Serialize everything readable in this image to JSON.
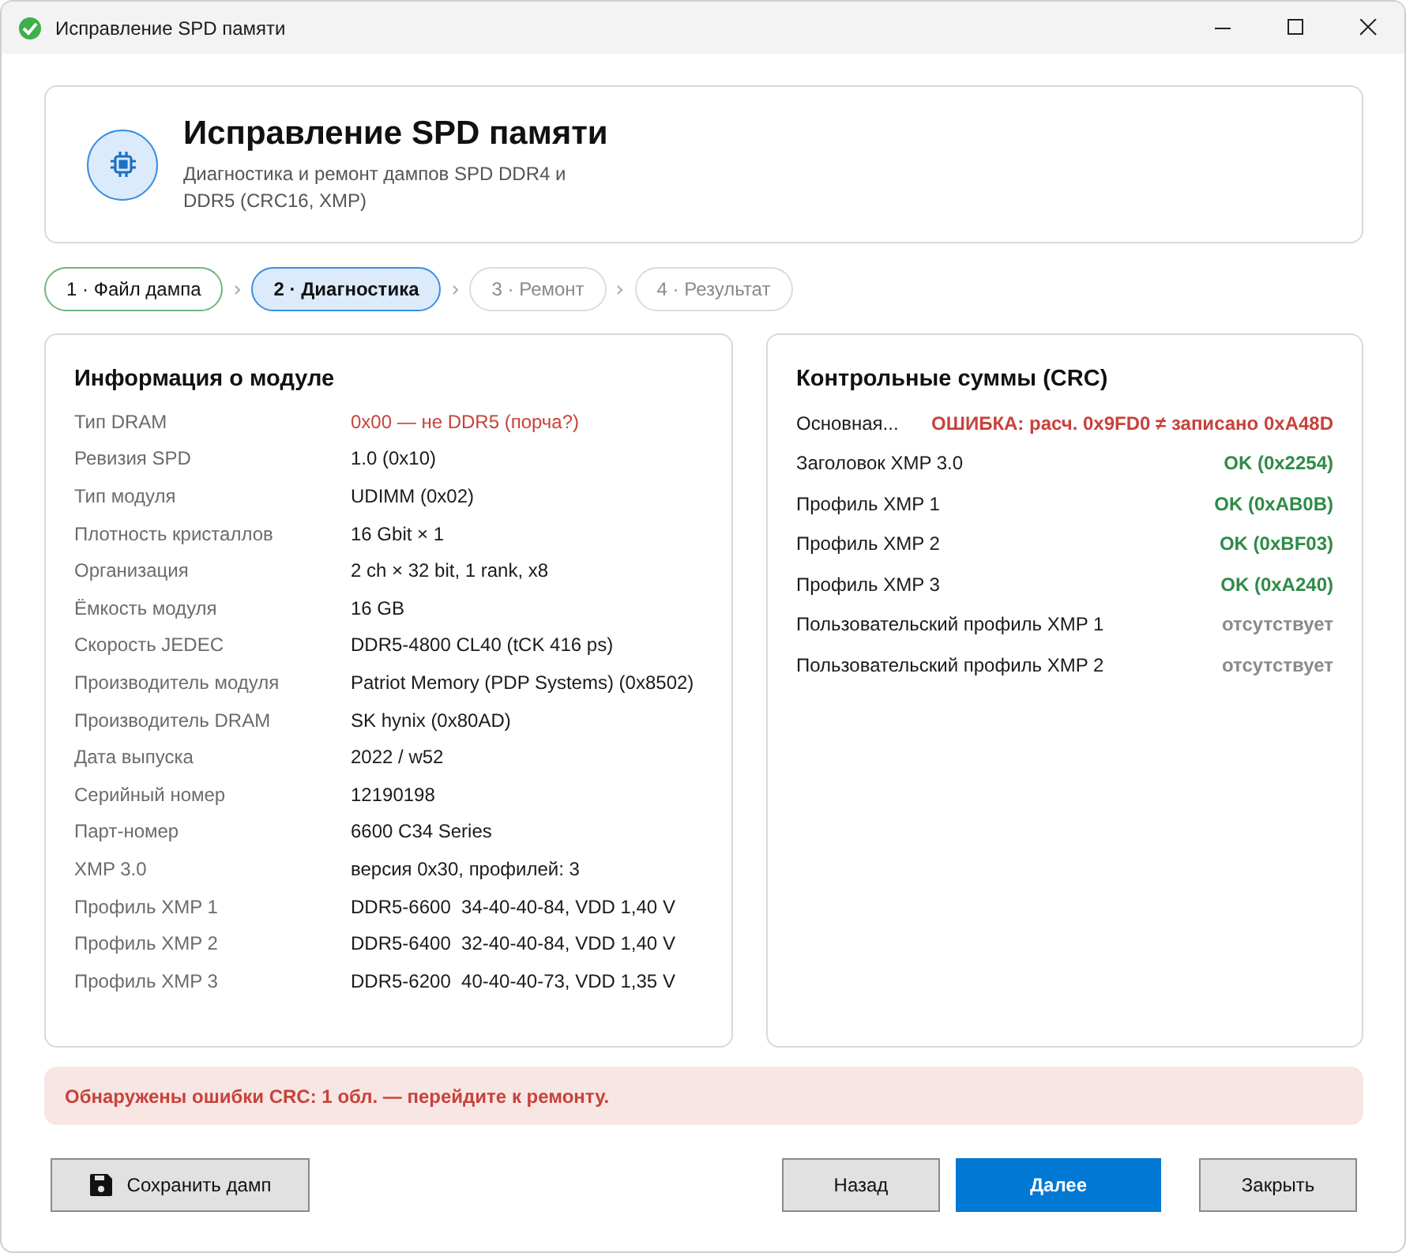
{
  "window": {
    "title": "Исправление SPD памяти"
  },
  "header": {
    "title": "Исправление SPD памяти",
    "subtitle": "Диагностика и ремонт дампов SPD DDR4 и DDR5 (CRC16, XMP)"
  },
  "steps": [
    {
      "label": "1 · Файл дампа",
      "kind": "done",
      "selected": false
    },
    {
      "label": "2 · Диагностика",
      "kind": "active",
      "selected": true
    },
    {
      "label": "3 · Ремонт",
      "kind": "pending",
      "selected": false
    },
    {
      "label": "4 · Результат",
      "kind": "pending",
      "selected": false
    }
  ],
  "module_info": {
    "title": "Информация о модуле",
    "rows": [
      {
        "label": "Тип DRAM",
        "value": "0x00 — не DDR5 (порча?)",
        "alert": true
      },
      {
        "label": "Ревизия SPD",
        "value": "1.0 (0x10)",
        "alert": false
      },
      {
        "label": "Тип модуля",
        "value": "UDIMM (0x02)",
        "alert": false
      },
      {
        "label": "Плотность кристаллов",
        "value": "16 Gbit × 1",
        "alert": false
      },
      {
        "label": "Организация",
        "value": "2 ch × 32 bit, 1 rank, x8",
        "alert": false
      },
      {
        "label": "Ёмкость модуля",
        "value": "16 GB",
        "alert": false
      },
      {
        "label": "Скорость JEDEC",
        "value": "DDR5-4800 CL40 (tCK 416 ps)",
        "alert": false
      },
      {
        "label": "Производитель модуля",
        "value": "Patriot Memory (PDP Systems) (0x8502)",
        "alert": false
      },
      {
        "label": "Производитель DRAM",
        "value": "SK hynix (0x80AD)",
        "alert": false
      },
      {
        "label": "Дата выпуска",
        "value": "2022 / w52",
        "alert": false
      },
      {
        "label": "Серийный номер",
        "value": "12190198",
        "alert": false
      },
      {
        "label": "Парт-номер",
        "value": "6600 C34 Series",
        "alert": false
      },
      {
        "label": "XMP 3.0",
        "value": "версия 0x30, профилей: 3",
        "alert": false
      },
      {
        "label": "Профиль XMP 1",
        "value": "DDR5-6600  34-40-40-84, VDD 1,40 V",
        "alert": false
      },
      {
        "label": "Профиль XMP 2",
        "value": "DDR5-6400  32-40-40-84, VDD 1,40 V",
        "alert": false
      },
      {
        "label": "Профиль XMP 3",
        "value": "DDR5-6200  40-40-40-73, VDD 1,35 V",
        "alert": false
      }
    ]
  },
  "checksums": {
    "title": "Контрольные суммы (CRC)",
    "rows": [
      {
        "label": "Основная...",
        "value": "ОШИБКА: расч. 0x9FD0 ≠ записано 0xA48D",
        "kind": "error"
      },
      {
        "label": "Заголовок XMP 3.0",
        "value": "OK (0x2254)",
        "kind": "ok"
      },
      {
        "label": "Профиль XMP 1",
        "value": "OK (0xAB0B)",
        "kind": "ok"
      },
      {
        "label": "Профиль XMP 2",
        "value": "OK (0xBF03)",
        "kind": "ok"
      },
      {
        "label": "Профиль XMP 3",
        "value": "OK (0xA240)",
        "kind": "ok"
      },
      {
        "label": "Пользовательский профиль XMP 1",
        "value": "отсутствует",
        "kind": "absent"
      },
      {
        "label": "Пользовательский профиль XMP 2",
        "value": "отсутствует",
        "kind": "absent"
      }
    ]
  },
  "alert": "Обнаружены ошибки CRC: 1 обл. — перейдите к ремонту.",
  "buttons": {
    "save": "Сохранить дамп",
    "back": "Назад",
    "next": "Далее",
    "close": "Закрыть"
  }
}
